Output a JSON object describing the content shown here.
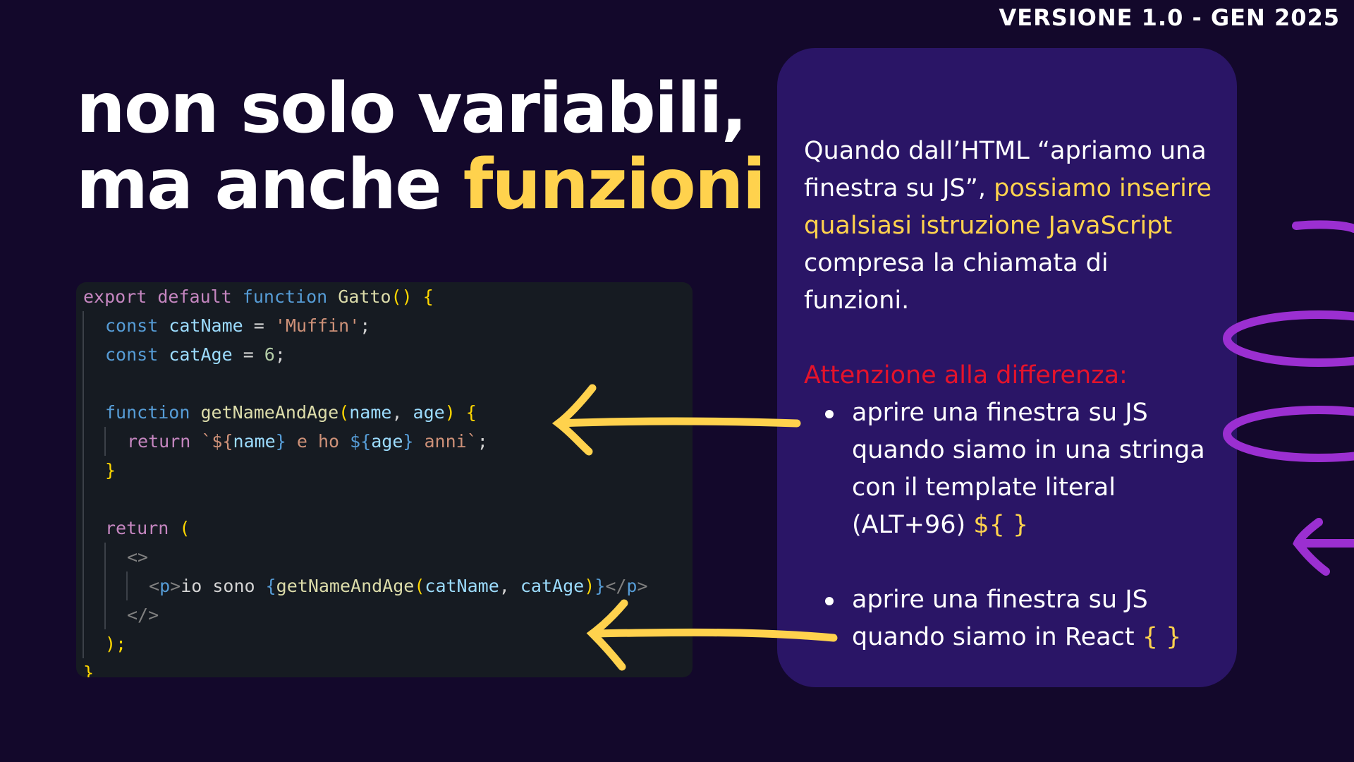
{
  "version": "VERSIONE 1.0 - GEN 2025",
  "title": {
    "line1": "non solo variabili,",
    "line2_prefix": "ma anche ",
    "line2_highlight": "funzioni"
  },
  "code": {
    "l1": [
      "export",
      " ",
      "default",
      " ",
      "function",
      " ",
      "Gatto",
      "() {"
    ],
    "l2": [
      "const",
      " ",
      "catName",
      " = ",
      "'Muffin'",
      ";"
    ],
    "l3": [
      "const",
      " ",
      "catAge",
      " = ",
      "6",
      ";"
    ],
    "l5": [
      "function",
      " ",
      "getNameAndAge",
      "(",
      "name",
      ", ",
      "age",
      ") {"
    ],
    "l6": [
      "return",
      " ",
      "`${",
      "name",
      "}",
      " e ho ",
      "${",
      "age",
      "}",
      " anni`",
      ";"
    ],
    "l7": "}",
    "l9": [
      "return",
      " ("
    ],
    "l10": "<>",
    "l11": [
      "<",
      "p",
      ">",
      "io sono ",
      "{",
      "getNameAndAge",
      "(",
      "catName",
      ", ",
      "catAge",
      ")",
      "}",
      "</",
      "p",
      ">"
    ],
    "l12": "</>",
    "l13": ");",
    "l14": "}"
  },
  "panel": {
    "intro_plain1": "Quando dall’HTML “apriamo una finestra su JS”, ",
    "intro_highlight": "possiamo inserire qualsiasi istruzione JavaScript",
    "intro_plain2": " compresa la chiamata di funzioni.",
    "warning": "Attenzione alla differenza:",
    "bullets": [
      {
        "text": "aprire una finestra su JS quando siamo in una stringa con il template literal (ALT+96) ",
        "code": "${ }"
      },
      {
        "text": "aprire una finestra su JS quando siamo in React ",
        "code": "{ }"
      }
    ]
  },
  "colors": {
    "background": "#13082b",
    "panel": "#2a1566",
    "highlight": "#ffd24d",
    "warning": "#e5132b",
    "decoration": "#9b2fd1"
  }
}
